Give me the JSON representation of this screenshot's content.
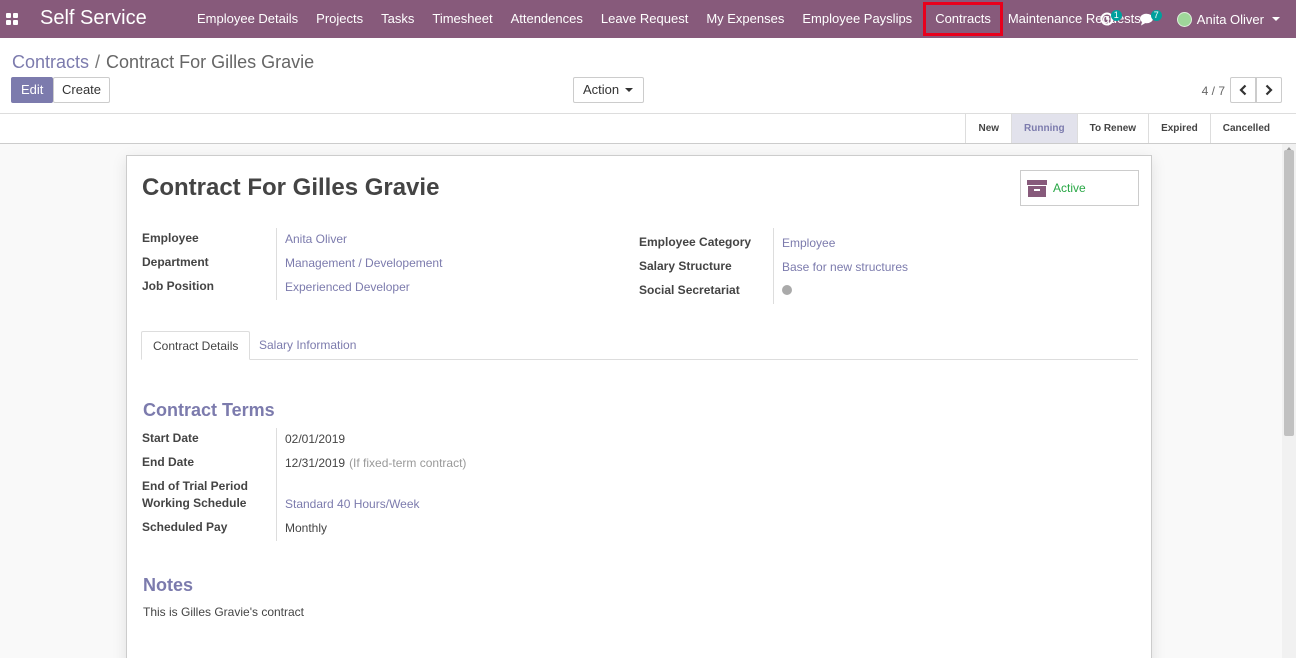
{
  "navbar": {
    "brand": "Self Service",
    "menu": [
      "Employee Details",
      "Projects",
      "Tasks",
      "Timesheet",
      "Attendences",
      "Leave Request",
      "My Expenses",
      "Employee Payslips",
      "Contracts",
      "Maintenance Requests"
    ],
    "highlighted_menu": "Contracts",
    "activity_count": "1",
    "messages_count": "7",
    "user_name": "Anita Oliver",
    "accent_color": "#875A7B",
    "highlight_color": "#e8001c"
  },
  "breadcrumb": {
    "parent": "Contracts",
    "separator": "/",
    "current": "Contract For Gilles Gravie"
  },
  "buttons": {
    "edit": "Edit",
    "create": "Create",
    "action": "Action"
  },
  "pager": {
    "value": "4 / 7"
  },
  "stages": [
    "New",
    "Running",
    "To Renew",
    "Expired",
    "Cancelled"
  ],
  "active_stage": "Running",
  "record": {
    "title": "Contract For Gilles Gravie",
    "status_button": "Active",
    "left_fields": [
      {
        "label": "Employee",
        "value": "Anita Oliver"
      },
      {
        "label": "Department",
        "value": "Management / Developement"
      },
      {
        "label": "Job Position",
        "value": "Experienced Developer"
      }
    ],
    "right_fields": [
      {
        "label": "Employee Category",
        "value": "Employee"
      },
      {
        "label": "Salary Structure",
        "value": "Base for new structures"
      },
      {
        "label": "Social Secretariat",
        "value": ""
      }
    ]
  },
  "tabs": [
    "Contract Details",
    "Salary Information"
  ],
  "contract_terms": {
    "title": "Contract Terms",
    "fields": [
      {
        "label": "Start Date",
        "value": "02/01/2019"
      },
      {
        "label": "End Date",
        "value": "12/31/2019",
        "hint": "(If fixed-term contract)"
      },
      {
        "label": "End of Trial Period",
        "value": ""
      },
      {
        "label": "Working Schedule",
        "value": "Standard 40 Hours/Week"
      },
      {
        "label": "Scheduled Pay",
        "value": "Monthly"
      }
    ]
  },
  "notes": {
    "title": "Notes",
    "text": "This is Gilles Gravie's contract"
  }
}
